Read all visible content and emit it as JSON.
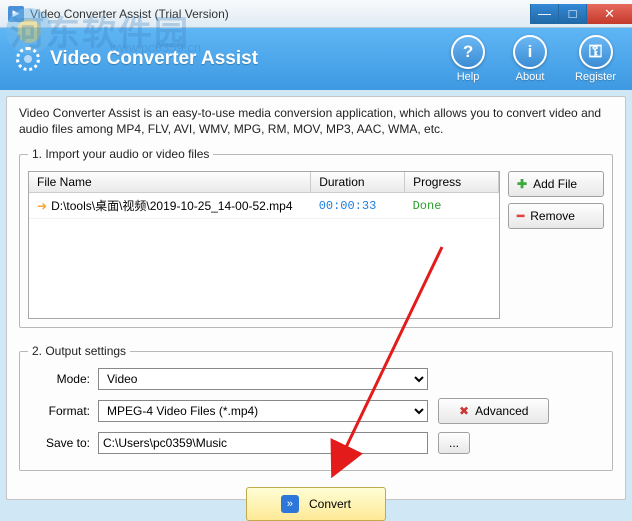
{
  "window": {
    "title": "Video Converter Assist (Trial Version)"
  },
  "banner": {
    "title": "Video Converter Assist",
    "buttons": {
      "help": "Help",
      "about": "About",
      "register": "Register"
    }
  },
  "description": "Video Converter Assist is an easy-to-use media conversion application, which allows you to convert video and audio files among MP4, FLV, AVI, WMV, MPG, RM, MOV, MP3, AAC, WMA, etc.",
  "import": {
    "legend": "1. Import your audio or video files",
    "headers": {
      "name": "File Name",
      "duration": "Duration",
      "progress": "Progress"
    },
    "rows": [
      {
        "name": "D:\\tools\\桌面\\视频\\2019-10-25_14-00-52.mp4",
        "duration": "00:00:33",
        "progress": "Done"
      }
    ],
    "addFile": "Add File",
    "remove": "Remove"
  },
  "output": {
    "legend": "2. Output settings",
    "modeLabel": "Mode:",
    "modeValue": "Video",
    "formatLabel": "Format:",
    "formatValue": "MPEG-4 Video Files (*.mp4)",
    "advanced": "Advanced",
    "saveToLabel": "Save to:",
    "saveToValue": "C:\\Users\\pc0359\\Music",
    "browse": "..."
  },
  "convert": "Convert",
  "watermark": {
    "text": "河东软件园",
    "url": "www.pc0359.cn"
  }
}
